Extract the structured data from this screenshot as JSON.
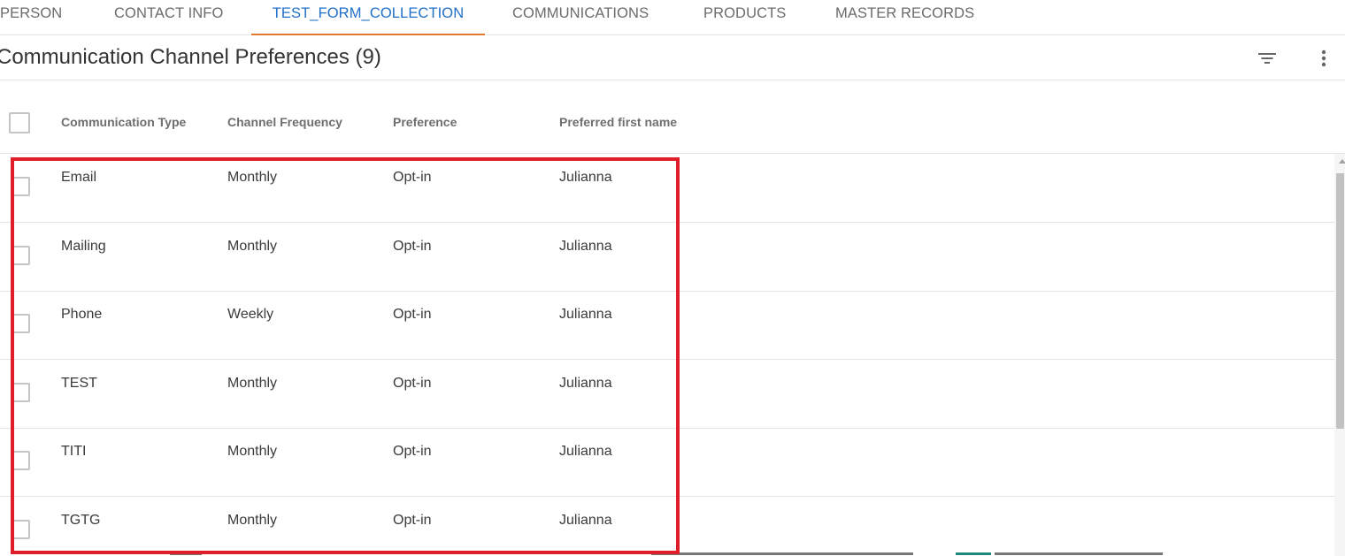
{
  "tabs": [
    {
      "label": "PERSON",
      "active": false
    },
    {
      "label": "CONTACT INFO",
      "active": false
    },
    {
      "label": "TEST_FORM_COLLECTION",
      "active": true
    },
    {
      "label": "COMMUNICATIONS",
      "active": false
    },
    {
      "label": "PRODUCTS",
      "active": false
    },
    {
      "label": "MASTER RECORDS",
      "active": false
    }
  ],
  "header": {
    "title": "Communication Channel Preferences (9)",
    "filter_icon": "filter-icon",
    "more_icon": "more-vert-icon"
  },
  "table": {
    "columns": [
      "Communication Type",
      "Channel Frequency",
      "Preference",
      "Preferred first name"
    ],
    "rows": [
      [
        "Email",
        "Monthly",
        "Opt-in",
        "Julianna"
      ],
      [
        "Mailing",
        "Monthly",
        "Opt-in",
        "Julianna"
      ],
      [
        "Phone",
        "Weekly",
        "Opt-in",
        "Julianna"
      ],
      [
        "TEST",
        "Monthly",
        "Opt-in",
        "Julianna"
      ],
      [
        "TITI",
        "Monthly",
        "Opt-in",
        "Julianna"
      ],
      [
        "TGTG",
        "Monthly",
        "Opt-in",
        "Julianna"
      ]
    ]
  },
  "colors": {
    "active_tab_text": "#1f6fc9",
    "active_tab_underline": "#e07a2f",
    "highlight_border": "#e01e2a"
  }
}
